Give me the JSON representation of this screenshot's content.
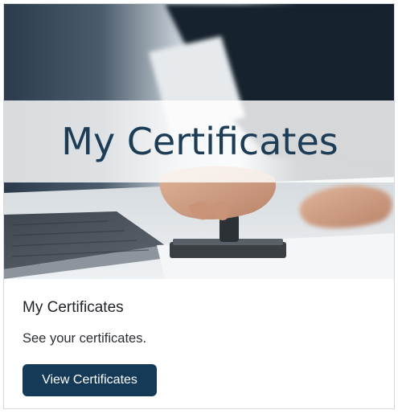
{
  "hero": {
    "banner_title": "My Certificates",
    "image_icon": "hand-stamping-document-photo"
  },
  "card": {
    "title": "My Certificates",
    "description": "See your certificates.",
    "button_label": "View Certificates"
  },
  "colors": {
    "banner_text": "#1d3d57",
    "button_bg": "#153a58",
    "button_text": "#ffffff"
  }
}
